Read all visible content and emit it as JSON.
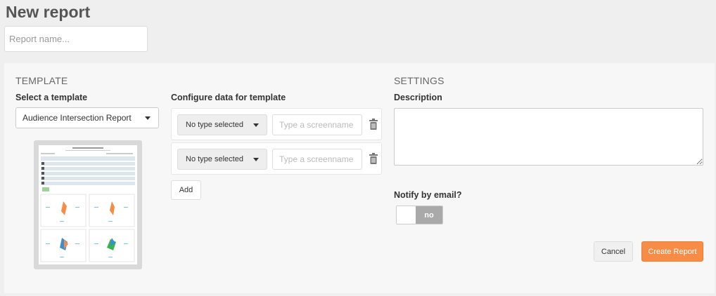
{
  "page": {
    "title": "New report",
    "report_name_placeholder": "Report name..."
  },
  "template": {
    "section_title": "TEMPLATE",
    "select_label": "Select a template",
    "selected": "Audience Intersection Report",
    "preview_icon": "report-preview-thumbnail"
  },
  "configure": {
    "label": "Configure data for template",
    "rows": [
      {
        "type": "No type selected",
        "screenname_placeholder": "Type a screenname",
        "icon": "trash-icon"
      },
      {
        "type": "No type selected",
        "screenname_placeholder": "Type a screenname",
        "icon": "trash-icon"
      }
    ],
    "add_label": "Add"
  },
  "settings": {
    "section_title": "SETTINGS",
    "description_label": "Description",
    "notify_label": "Notify by email?",
    "notify_state": "no"
  },
  "actions": {
    "cancel_label": "Cancel",
    "create_label": "Create Report"
  },
  "colors": {
    "accent": "#f68c45",
    "toggle_off": "#a9a9a9",
    "background": "#efefef",
    "panel": "#f7f7f7"
  }
}
